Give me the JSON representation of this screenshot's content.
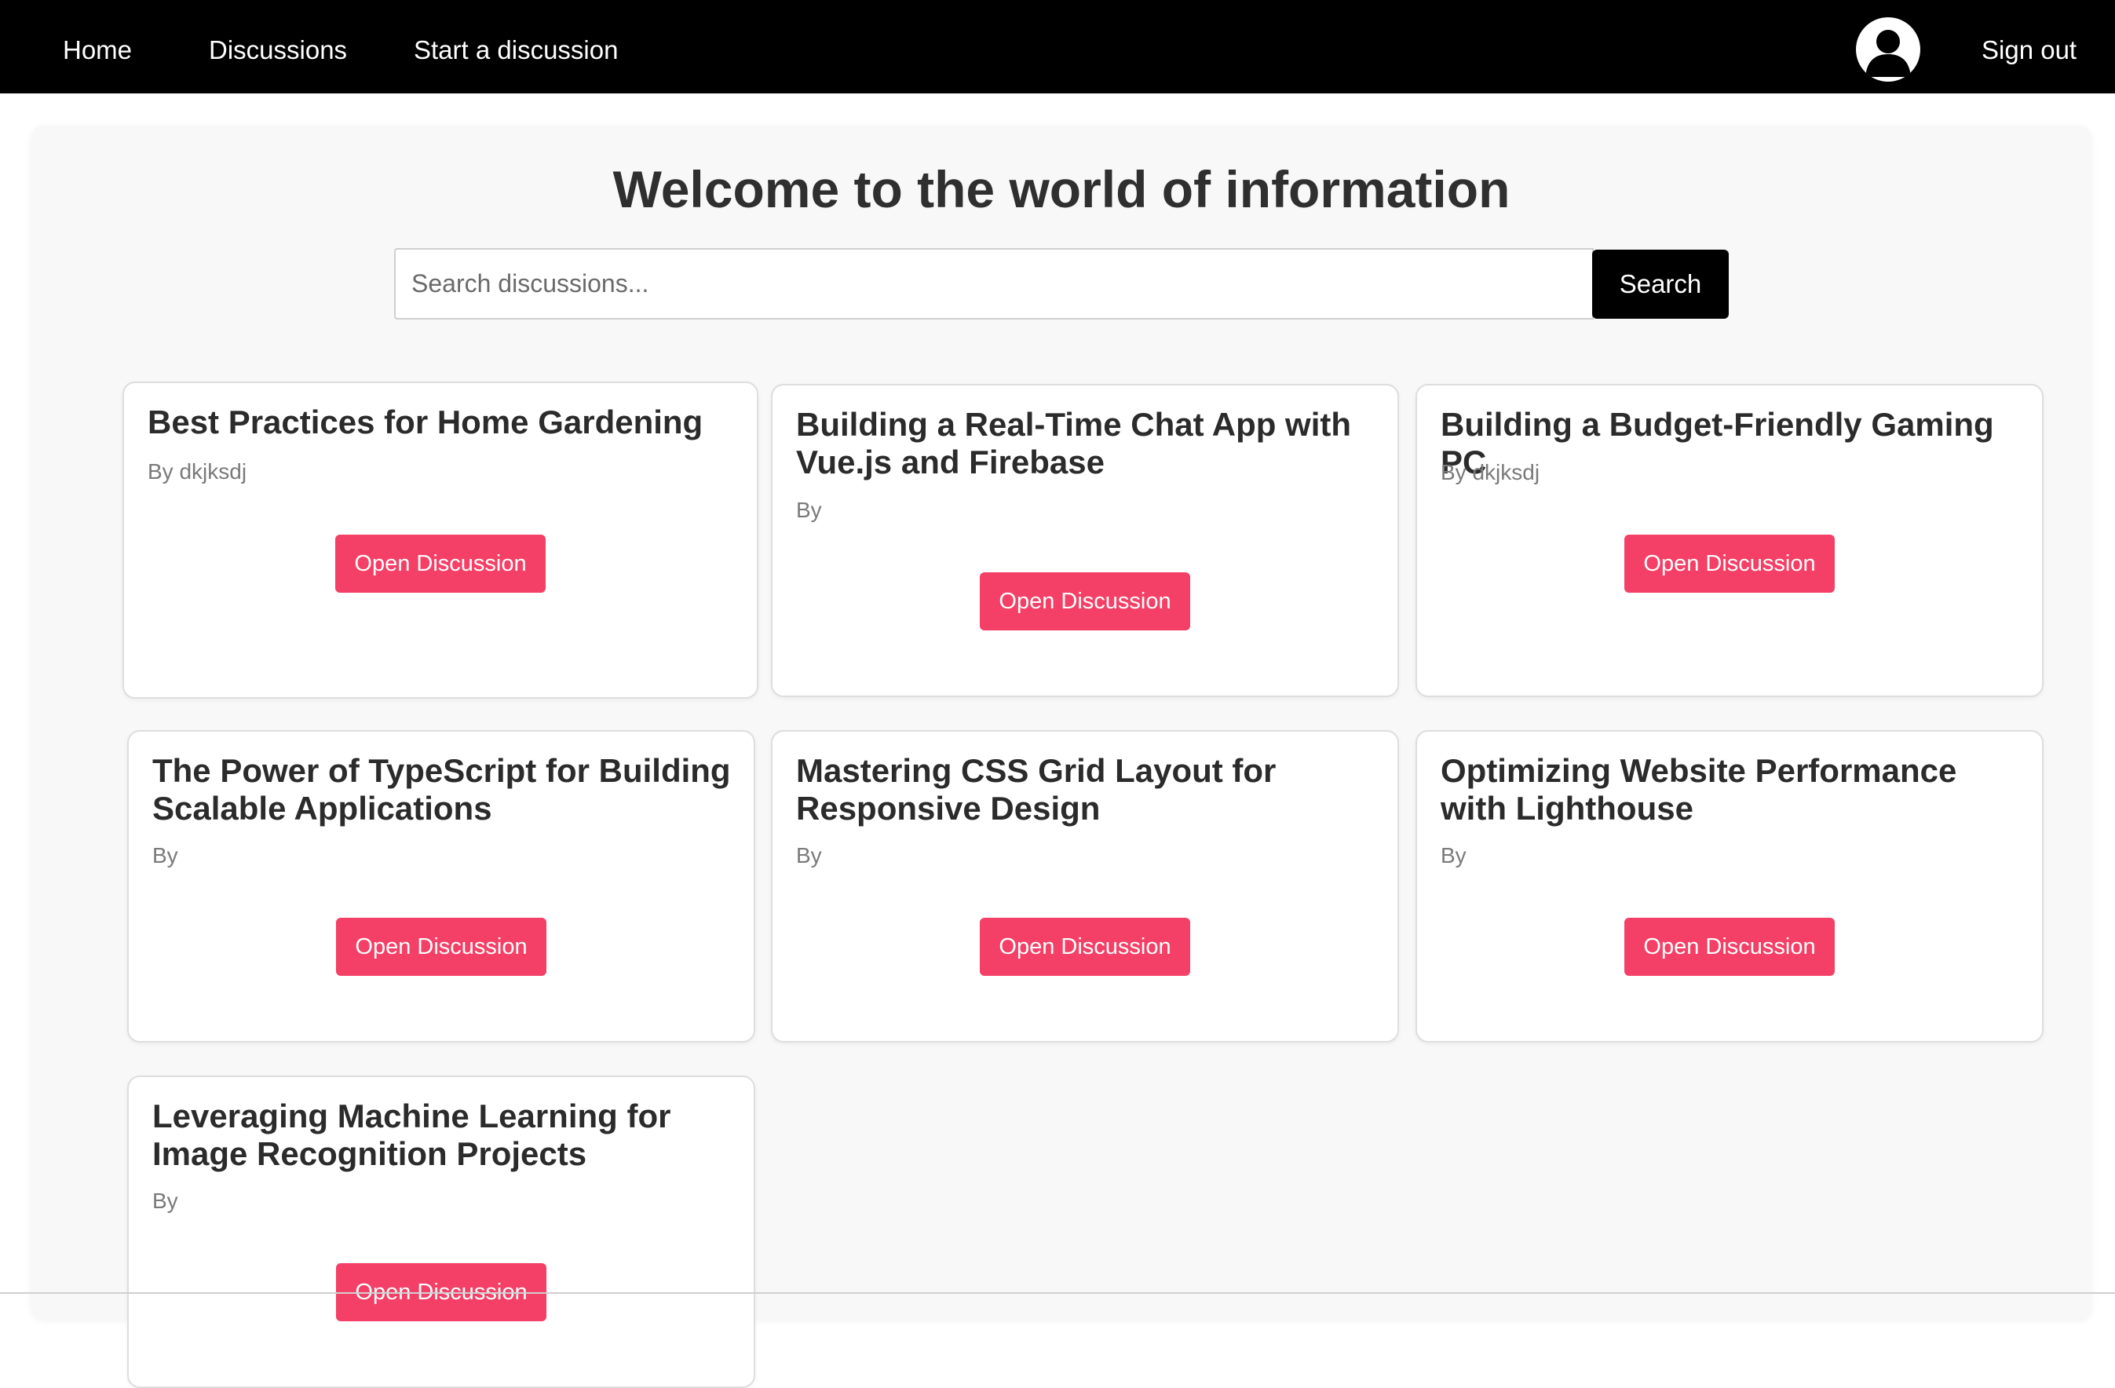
{
  "nav": {
    "home": "Home",
    "discussions": "Discussions",
    "start": "Start a discussion",
    "sign_out": "Sign out",
    "avatar_icon": "user-avatar-icon"
  },
  "main": {
    "title": "Welcome to the world of information",
    "search_placeholder": "Search discussions...",
    "search_button": "Search"
  },
  "colors": {
    "navbar": "#000000",
    "accent_button": "#f43f66",
    "panel_background": "#f8f8f8"
  },
  "cards": [
    {
      "title": "Best Practices for Home Gardening",
      "author": "By dkjksdj",
      "button": "Open Discussion"
    },
    {
      "title": "Building a Real-Time Chat App with Vue.js and Firebase",
      "author": "By",
      "button": "Open Discussion"
    },
    {
      "title": "Building a Budget-Friendly Gaming PC",
      "author": "By dkjksdj",
      "button": "Open Discussion"
    },
    {
      "title": "The Power of TypeScript for Building Scalable Applications",
      "author": "By",
      "button": "Open Discussion"
    },
    {
      "title": "Mastering CSS Grid Layout for Responsive Design",
      "author": "By",
      "button": "Open Discussion"
    },
    {
      "title": "Optimizing Website Performance with Lighthouse",
      "author": "By",
      "button": "Open Discussion"
    },
    {
      "title": "Leveraging Machine Learning for Image Recognition Projects",
      "author": "By",
      "button": "Open Discussion"
    }
  ]
}
